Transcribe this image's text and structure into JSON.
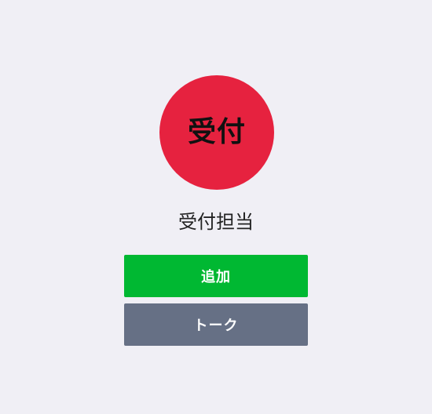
{
  "profile": {
    "avatar_text": "受付",
    "name": "受付担当"
  },
  "actions": {
    "add_label": "追加",
    "talk_label": "トーク"
  },
  "colors": {
    "background": "#f0eff5",
    "avatar": "#e6223f",
    "add_button": "#00b832",
    "talk_button": "#667085"
  }
}
